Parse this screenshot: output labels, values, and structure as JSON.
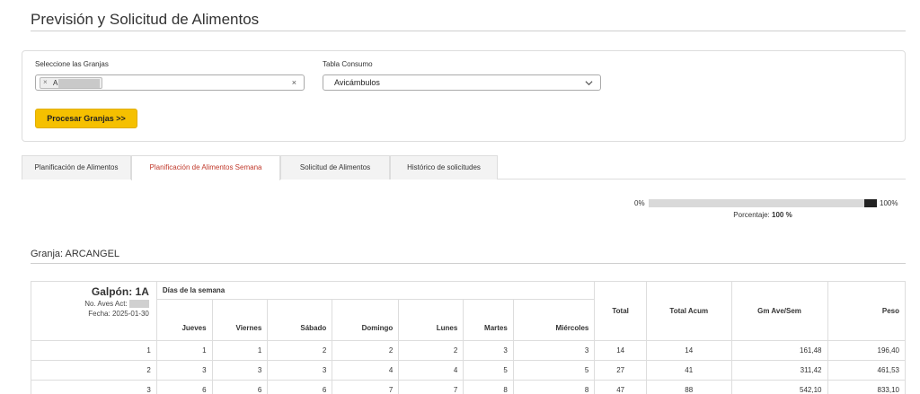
{
  "page": {
    "title": "Previsión y Solicitud de Alimentos"
  },
  "filters": {
    "farms_label": "Seleccione las Granjas",
    "farm_chip_remove": "×",
    "farm_chip_text": "A",
    "clear_symbol": "×",
    "consumption_label": "Tabla Consumo",
    "consumption_value": "Avicámbulos",
    "process_button": "Procesar Granjas >>"
  },
  "tabs": [
    {
      "label": "Planificación de Alimentos",
      "active": false
    },
    {
      "label": "Planificación de Alimentos Semana",
      "active": true
    },
    {
      "label": "Solicitud de Alimentos",
      "active": false
    },
    {
      "label": "Histórico de solicitudes",
      "active": false
    }
  ],
  "progress": {
    "start_label": "0%",
    "end_label": "100%",
    "caption_prefix": "Porcentaje:",
    "caption_value": "100 %",
    "fraction": 1.0
  },
  "farm": {
    "title": "Granja: ARCANGEL"
  },
  "table": {
    "galpon": "Galpón: 1A",
    "aves_label": "No. Aves Act:",
    "fecha_label": "Fecha: 2025-01-30",
    "days_header": "Días de la semana",
    "day_columns": [
      "Jueves",
      "Viernes",
      "Sábado",
      "Domingo",
      "Lunes",
      "Martes",
      "Miércoles"
    ],
    "total_columns": [
      "Total",
      "Total Acum",
      "Gm Ave/Sem",
      "Peso"
    ],
    "rows": [
      [
        "1",
        "1",
        "1",
        "2",
        "2",
        "2",
        "3",
        "3",
        "14",
        "14",
        "161,48",
        "196,40"
      ],
      [
        "2",
        "3",
        "3",
        "3",
        "4",
        "4",
        "5",
        "5",
        "27",
        "41",
        "311,42",
        "461,53"
      ],
      [
        "3",
        "6",
        "6",
        "6",
        "7",
        "7",
        "8",
        "8",
        "47",
        "88",
        "542,10",
        "833,10"
      ]
    ]
  },
  "colors": {
    "accent": "#f5c000",
    "active_tab": "#c0392b",
    "progress": "#222222"
  }
}
